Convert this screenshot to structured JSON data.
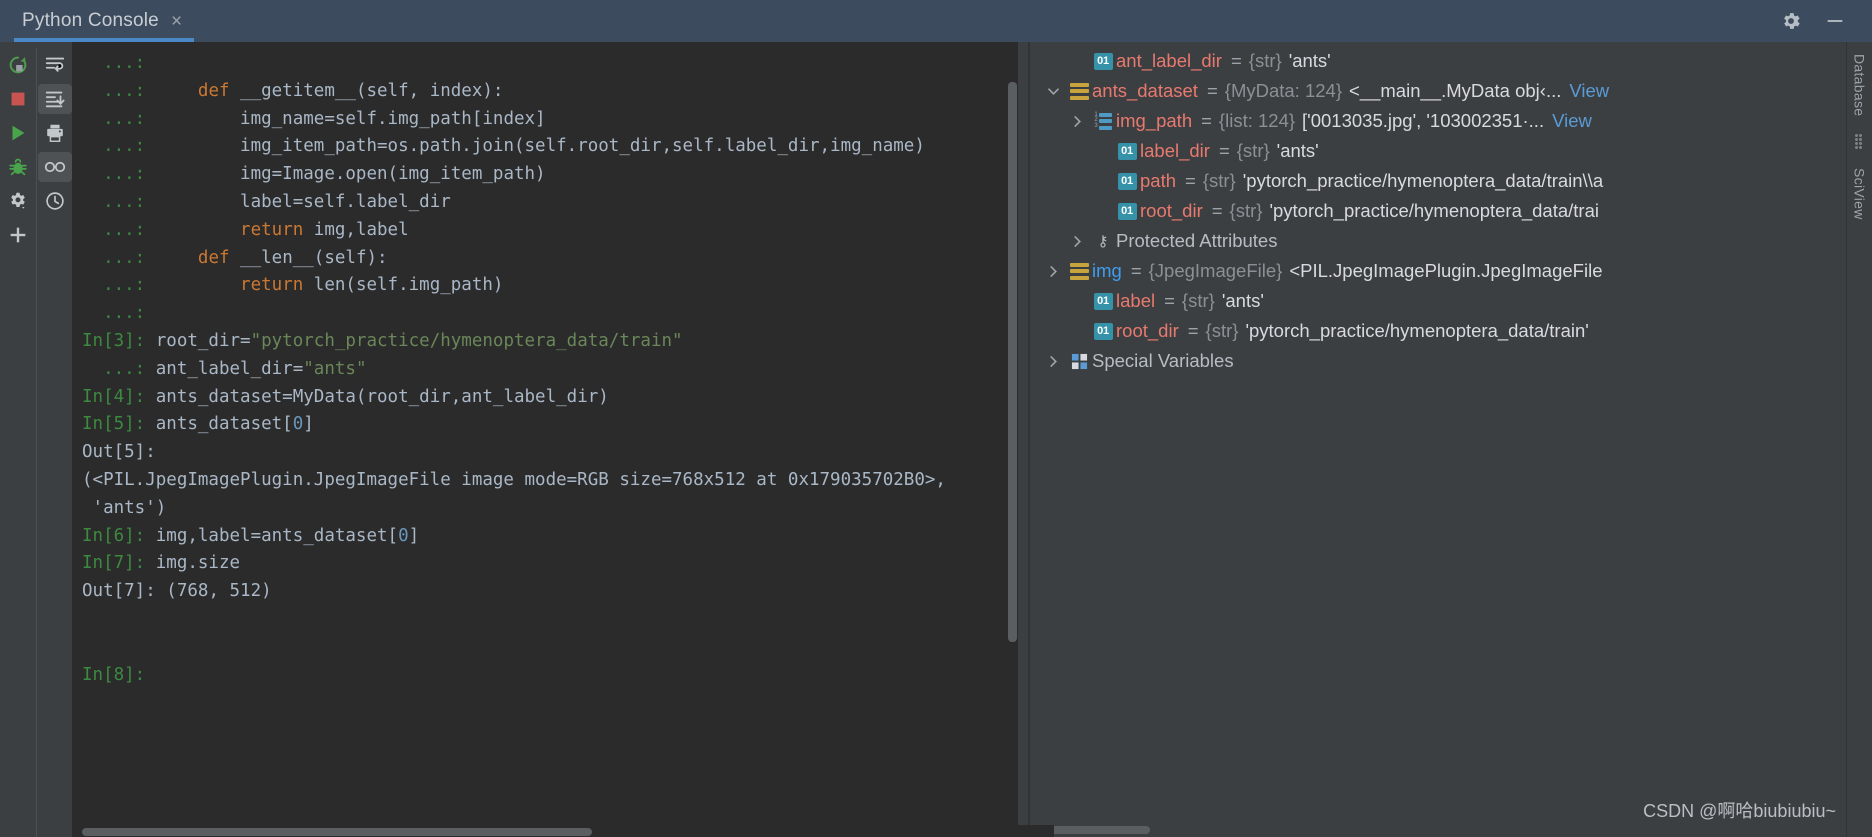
{
  "window": {
    "tab_title": "Python Console",
    "close_label": "×",
    "settings_icon": "gear-icon",
    "minimize_icon": "minimize-icon"
  },
  "toolbar": {
    "left_column": [
      {
        "name": "rerun-button",
        "icon": "rerun-icon",
        "active": false
      },
      {
        "name": "stop-button",
        "icon": "stop-square-icon",
        "active": false
      },
      {
        "name": "execute-button",
        "icon": "play-triangle-icon",
        "active": false
      },
      {
        "name": "debug-button",
        "icon": "bug-icon",
        "active": false
      },
      {
        "name": "settings-button",
        "icon": "gear-dropdown-icon",
        "active": false
      },
      {
        "name": "new-console-button",
        "icon": "plus-icon",
        "active": false
      }
    ],
    "right_column": [
      {
        "name": "soft-wrap-button",
        "icon": "soft-wrap-icon",
        "active": false
      },
      {
        "name": "scroll-to-end-button",
        "icon": "scroll-to-end-icon",
        "active": true
      },
      {
        "name": "print-button",
        "icon": "printer-icon",
        "active": false
      },
      {
        "name": "view-as-button",
        "icon": "glasses-icon",
        "active": true
      },
      {
        "name": "history-button",
        "icon": "clock-icon",
        "active": false
      }
    ]
  },
  "console": {
    "lines": [
      {
        "prompt": "  ...:",
        "prompt_class": "p-cont",
        "segments": []
      },
      {
        "prompt": "  ...:",
        "prompt_class": "p-cont",
        "segments": [
          {
            "t": "     ",
            "c": "txt"
          },
          {
            "t": "def",
            "c": "kw"
          },
          {
            "t": " __getitem__(self, index):",
            "c": "txt"
          }
        ]
      },
      {
        "prompt": "  ...:",
        "prompt_class": "p-cont",
        "segments": [
          {
            "t": "         img_name=self.img_path[index]",
            "c": "txt"
          }
        ]
      },
      {
        "prompt": "  ...:",
        "prompt_class": "p-cont",
        "segments": [
          {
            "t": "         img_item_path=os.path.join(self.root_dir,self.label_dir,img_name)",
            "c": "txt"
          }
        ]
      },
      {
        "prompt": "  ...:",
        "prompt_class": "p-cont",
        "segments": [
          {
            "t": "         img=Image.open(img_item_path)",
            "c": "txt"
          }
        ]
      },
      {
        "prompt": "  ...:",
        "prompt_class": "p-cont",
        "segments": [
          {
            "t": "         label=self.label_dir",
            "c": "txt"
          }
        ]
      },
      {
        "prompt": "  ...:",
        "prompt_class": "p-cont",
        "segments": [
          {
            "t": "         ",
            "c": "txt"
          },
          {
            "t": "return",
            "c": "kw"
          },
          {
            "t": " img,label",
            "c": "txt"
          }
        ]
      },
      {
        "prompt": "  ...:",
        "prompt_class": "p-cont",
        "segments": [
          {
            "t": "     ",
            "c": "txt"
          },
          {
            "t": "def",
            "c": "kw"
          },
          {
            "t": " __len__(self):",
            "c": "txt"
          }
        ]
      },
      {
        "prompt": "  ...:",
        "prompt_class": "p-cont",
        "segments": [
          {
            "t": "         ",
            "c": "txt"
          },
          {
            "t": "return",
            "c": "kw"
          },
          {
            "t": " len(self.img_path)",
            "c": "txt"
          }
        ]
      },
      {
        "prompt": "  ...:",
        "prompt_class": "p-cont",
        "segments": []
      },
      {
        "prompt": "In[3]:",
        "prompt_class": "p-in",
        "segments": [
          {
            "t": " root_dir=",
            "c": "txt"
          },
          {
            "t": "\"pytorch_practice/hymenoptera_data/train\"",
            "c": "str"
          }
        ]
      },
      {
        "prompt": "  ...:",
        "prompt_class": "p-cont",
        "segments": [
          {
            "t": " ant_label_dir=",
            "c": "txt"
          },
          {
            "t": "\"ants\"",
            "c": "str"
          }
        ]
      },
      {
        "prompt": "In[4]:",
        "prompt_class": "p-in",
        "segments": [
          {
            "t": " ants_dataset=MyData(root_dir,ant_label_dir)",
            "c": "txt"
          }
        ]
      },
      {
        "prompt": "In[5]:",
        "prompt_class": "p-in",
        "segments": [
          {
            "t": " ants_dataset[",
            "c": "txt"
          },
          {
            "t": "0",
            "c": "num"
          },
          {
            "t": "]",
            "c": "txt"
          }
        ]
      },
      {
        "prompt": "Out[5]:",
        "prompt_class": "p-out",
        "segments": []
      },
      {
        "prompt": "",
        "prompt_class": "p-out",
        "segments": [
          {
            "t": "(<PIL.JpegImagePlugin.JpegImageFile image mode=RGB size=768x512 at 0x179035702B0>,",
            "c": "txt"
          }
        ]
      },
      {
        "prompt": "",
        "prompt_class": "p-out",
        "segments": [
          {
            "t": " 'ants')",
            "c": "txt"
          }
        ]
      },
      {
        "prompt": "In[6]:",
        "prompt_class": "p-in",
        "segments": [
          {
            "t": " img,label=ants_dataset[",
            "c": "txt"
          },
          {
            "t": "0",
            "c": "num"
          },
          {
            "t": "]",
            "c": "txt"
          }
        ]
      },
      {
        "prompt": "In[7]:",
        "prompt_class": "p-in",
        "segments": [
          {
            "t": " img.size",
            "c": "txt"
          }
        ]
      },
      {
        "prompt": "Out[7]:",
        "prompt_class": "p-out",
        "segments": [
          {
            "t": " (768, 512)",
            "c": "txt"
          }
        ]
      },
      {
        "prompt": "",
        "prompt_class": "p-out",
        "segments": []
      },
      {
        "prompt": "",
        "prompt_class": "p-out",
        "segments": []
      },
      {
        "prompt": "In[8]:",
        "prompt_class": "p-in",
        "segments": []
      }
    ]
  },
  "variables": {
    "rows": [
      {
        "indent": 1,
        "arrow": "",
        "icon": "string-badge-icon",
        "name": "ant_label_dir",
        "eq": "=",
        "type": "{str}",
        "value": "'ants'",
        "view": "",
        "name_color": "salmon"
      },
      {
        "indent": 0,
        "arrow": "down",
        "icon": "object-bars-icon",
        "name": "ants_dataset",
        "eq": "=",
        "type": "{MyData: 124}",
        "value": "<__main__.MyData obj‹...",
        "view": "View",
        "name_color": "salmon"
      },
      {
        "indent": 1,
        "arrow": "right",
        "icon": "list-bars-icon",
        "name": "img_path",
        "eq": "=",
        "type": "{list: 124}",
        "value": "['0013035.jpg', '103002351·...",
        "view": "View",
        "name_color": "salmon"
      },
      {
        "indent": 2,
        "arrow": "",
        "icon": "string-badge-icon",
        "name": "label_dir",
        "eq": "=",
        "type": "{str}",
        "value": "'ants'",
        "view": "",
        "name_color": "salmon"
      },
      {
        "indent": 2,
        "arrow": "",
        "icon": "string-badge-icon",
        "name": "path",
        "eq": "=",
        "type": "{str}",
        "value": "'pytorch_practice/hymenoptera_data/train\\\\a",
        "view": "",
        "name_color": "salmon"
      },
      {
        "indent": 2,
        "arrow": "",
        "icon": "string-badge-icon",
        "name": "root_dir",
        "eq": "=",
        "type": "{str}",
        "value": "'pytorch_practice/hymenoptera_data/trai",
        "view": "",
        "name_color": "salmon"
      },
      {
        "indent": 1,
        "arrow": "right",
        "icon": "key-icon",
        "name": "",
        "eq": "",
        "type": "",
        "value": "",
        "group": "Protected Attributes",
        "view": "",
        "name_color": "salmon"
      },
      {
        "indent": 0,
        "arrow": "right",
        "icon": "object-bars-icon",
        "name": "img",
        "eq": "=",
        "type": "{JpegImageFile}",
        "value": "<PIL.JpegImagePlugin.JpegImageFile",
        "view": "",
        "name_color": "blue"
      },
      {
        "indent": 1,
        "arrow": "",
        "icon": "string-badge-icon",
        "name": "label",
        "eq": "=",
        "type": "{str}",
        "value": "'ants'",
        "view": "",
        "name_color": "salmon"
      },
      {
        "indent": 1,
        "arrow": "",
        "icon": "string-badge-icon",
        "name": "root_dir",
        "eq": "=",
        "type": "{str}",
        "value": "'pytorch_practice/hymenoptera_data/train'",
        "view": "",
        "name_color": "salmon"
      },
      {
        "indent": 0,
        "arrow": "right",
        "icon": "special-vars-icon",
        "name": "",
        "eq": "",
        "type": "",
        "value": "",
        "group": "Special Variables",
        "view": "",
        "name_color": "salmon"
      }
    ]
  },
  "right_strip": {
    "tabs": [
      {
        "name": "tool-tab-database",
        "label": "Database"
      },
      {
        "name": "tool-tab-sciview",
        "label": "SciView"
      }
    ]
  },
  "watermark": {
    "text": "CSDN @啊哈biubiubiu~"
  }
}
